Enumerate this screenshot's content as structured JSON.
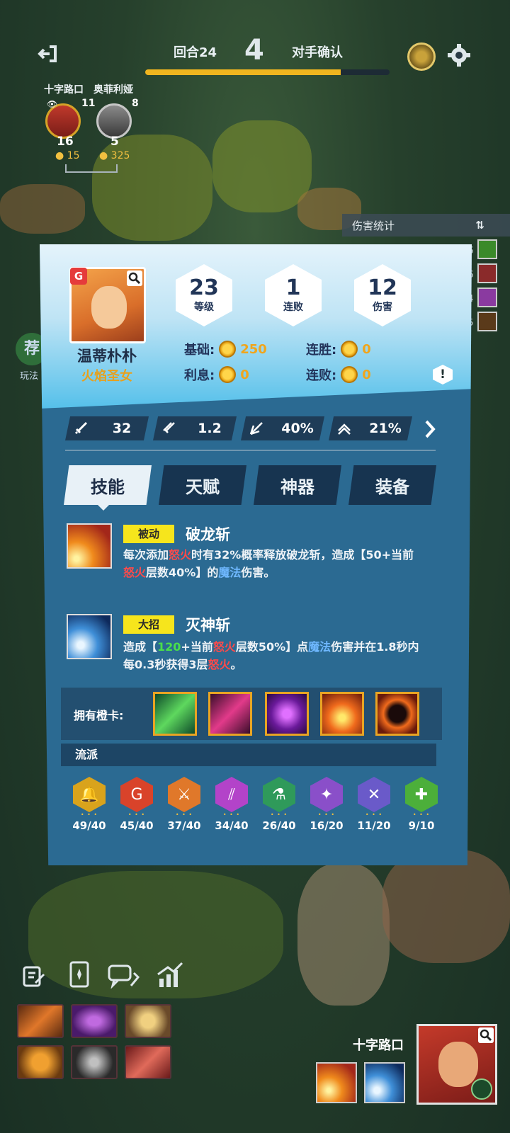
{
  "topbar": {
    "round_label": "回合24",
    "round_number": "4",
    "opponent_label": "对手确认",
    "round_progress": 0.8
  },
  "players": [
    {
      "name": "十字路口",
      "hp": "16",
      "gold": "15",
      "level": "11"
    },
    {
      "name": "奥菲利娅",
      "hp": "5",
      "gold": "325",
      "level": "8"
    }
  ],
  "damage_stats_label": "伤害统计",
  "damage_side_values": [
    "26",
    "36",
    "24",
    "15"
  ],
  "hero": {
    "name": "温蒂朴朴",
    "title": "火焰圣女",
    "level": "23",
    "level_label": "等级",
    "losses": "1",
    "losses_label": "连败",
    "damage": "12",
    "damage_label": "伤害",
    "base_label": "基础:",
    "base_value": "250",
    "interest_label": "利息:",
    "interest_value": "0",
    "winstreak_label": "连胜:",
    "winstreak_value": "0",
    "losestreak_label": "连败:",
    "losestreak_value": "0"
  },
  "stats": {
    "attack": "32",
    "attack_speed": "1.2",
    "crit": "40%",
    "dodge": "21%"
  },
  "tabs": [
    "技能",
    "天赋",
    "神器",
    "装备"
  ],
  "skills": [
    {
      "tag": "被动",
      "name": "破龙斩"
    },
    {
      "tag": "大招",
      "name": "灭神斩"
    }
  ],
  "skill1_desc": {
    "a": "每次添加",
    "b": "怒火",
    "c": "时有32%概率释放破龙斩，造成【50+当前",
    "d": "怒火",
    "e": "层数40%】的",
    "f": "魔法",
    "g": "伤害。"
  },
  "skill2_desc": {
    "a": "造成【",
    "b": "120",
    "c": "+当前",
    "d": "怒火",
    "e": "层数50%】点",
    "f": "魔法",
    "g": "伤害并在1.8秒内每0.3秒获得3层",
    "h": "怒火",
    "i": "。"
  },
  "orange_cards_label": "拥有橙卡:",
  "style_label": "流派",
  "traits": [
    {
      "count": "49/40",
      "color": "#d9a31c",
      "icon": "bell-icon"
    },
    {
      "count": "45/40",
      "color": "#d9432a",
      "icon": "flame-g-icon"
    },
    {
      "count": "37/40",
      "color": "#e0782a",
      "icon": "sword-crest-icon"
    },
    {
      "count": "34/40",
      "color": "#b343c9",
      "icon": "claw-icon"
    },
    {
      "count": "26/40",
      "color": "#2f9a5a",
      "icon": "potion-icon"
    },
    {
      "count": "16/20",
      "color": "#8a4fc9",
      "icon": "leaf-icon"
    },
    {
      "count": "11/20",
      "color": "#6a5ac9",
      "icon": "cross-swords-icon"
    },
    {
      "count": "9/10",
      "color": "#4caf3a",
      "icon": "plus-icon"
    }
  ],
  "me": {
    "name": "十字路口"
  },
  "colors": {
    "panel": "#2b6a92",
    "accent_gold": "#f0b51f",
    "tag_yellow": "#f6e51c"
  }
}
